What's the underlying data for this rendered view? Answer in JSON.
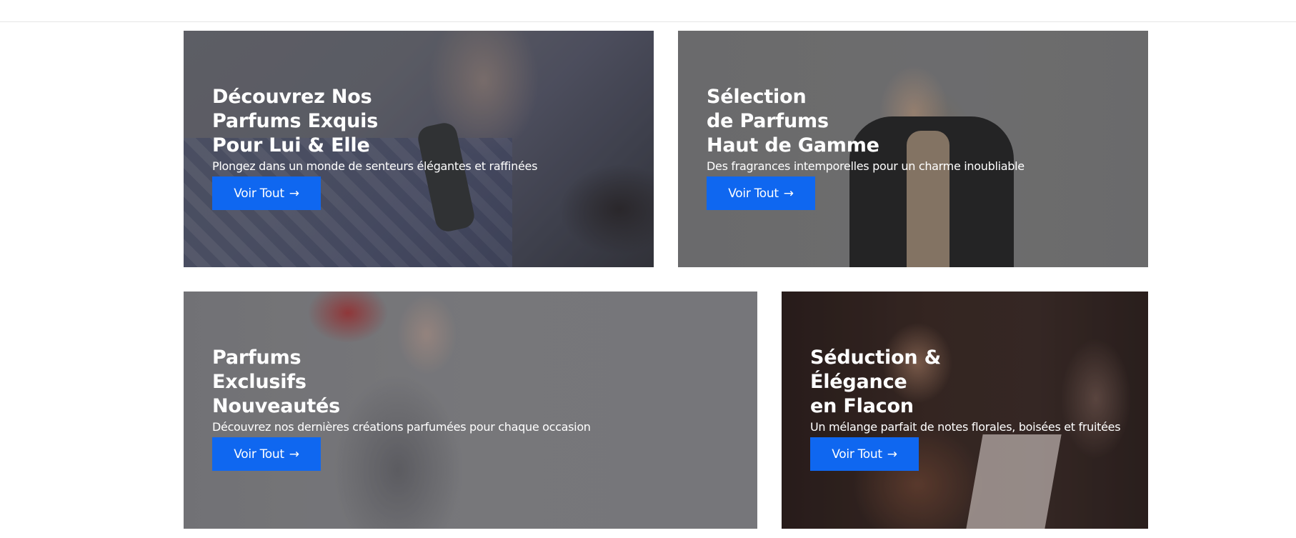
{
  "banners": [
    {
      "title_lines": [
        "Découvrez Nos",
        "Parfums Exquis",
        "Pour Lui & Elle"
      ],
      "subtitle": "Plongez dans un monde de senteurs élégantes et raffinées",
      "button_label": "Voir Tout",
      "button_icon": "arrow-right-icon"
    },
    {
      "title_lines": [
        "Sélection",
        "de Parfums",
        "Haut de Gamme"
      ],
      "subtitle": "Des fragrances intemporelles pour un charme inoubliable",
      "button_label": "Voir Tout",
      "button_icon": "arrow-right-icon"
    },
    {
      "title_lines": [
        "Parfums",
        "Exclusifs",
        "Nouveautés"
      ],
      "subtitle": "Découvrez nos dernières créations parfumées pour chaque occasion",
      "button_label": "Voir Tout",
      "button_icon": "arrow-right-icon"
    },
    {
      "title_lines": [
        "Séduction &",
        "Élégance",
        "en Flacon"
      ],
      "subtitle": "Un mélange parfait de notes florales, boisées et fruitées",
      "button_label": "Voir Tout",
      "button_icon": "arrow-right-icon"
    }
  ],
  "colors": {
    "button": "#0f67f0",
    "text": "#ffffff"
  }
}
